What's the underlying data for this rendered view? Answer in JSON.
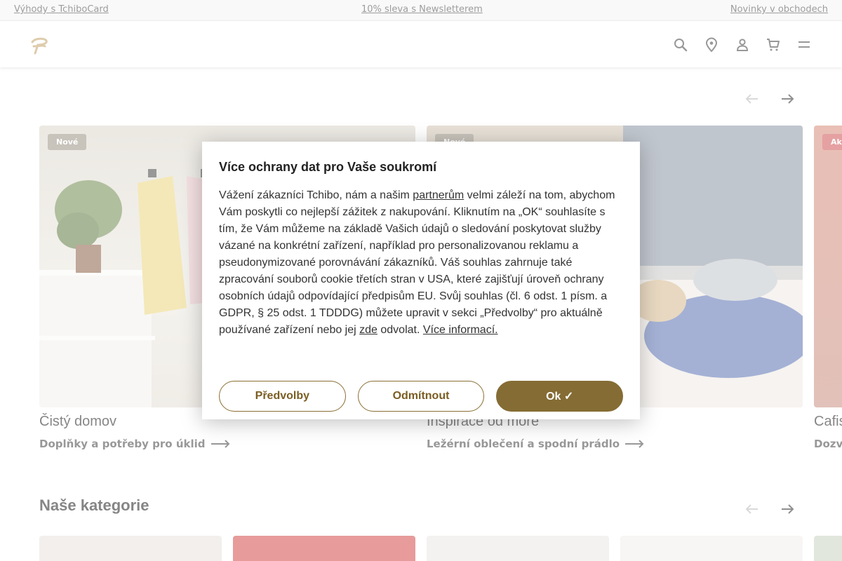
{
  "topbar": {
    "link1": "Výhody s TchiboCard",
    "link2": "10% sleva s Newsletterem",
    "link3": "Novinky v obchodech"
  },
  "header": {
    "icons": [
      "search-icon",
      "location-pin-icon",
      "user-icon",
      "cart-icon",
      "menu-icon"
    ]
  },
  "carousel": {
    "cards": [
      {
        "badge": "Nové",
        "title": "Čistý domov",
        "link": "Doplňky a potřeby pro úklid"
      },
      {
        "badge": "Nové",
        "title": "Inspirace od moře",
        "link": "Ležérní oblečení a spodní prádlo"
      },
      {
        "badge": "Akce",
        "title": "Cafissimo",
        "link": "Dozvědět se více"
      }
    ]
  },
  "categories": {
    "title": "Naše kategorie"
  },
  "modal": {
    "title": "Více ochrany dat pro Vaše soukromí",
    "body_intro": "Vážení zákazníci Tchibo, nám a našim ",
    "partners_link": "partnerům",
    "body_main": " velmi záleží na tom, abychom Vám poskytli co nejlepší zážitek z nakupování. Kliknutím na „OK“ souhlasíte s tím, že Vám můžeme na základě Vašich údajů o sledování poskytovat služby vázané na konkrétní zařízení, například pro personalizovanou reklamu a pseudonymizované porovnávání zákazníků. Váš souhlas zahrnuje také zpracování souborů cookie třetích stran v USA, které zajišťují úroveň ochrany osobních údajů odpovídající předpisům EU. Svůj souhlas (čl. 6 odst. 1 písm. a GDPR, § 25 odst. 1 TDDDG) můžete upravit v sekci „Předvolby“ pro aktuálně používané zařízení nebo jej ",
    "here_link": "zde",
    "body_end": " odvolat. ",
    "more_link": "Více informací.",
    "btn_preferences": "Předvolby",
    "btn_reject": "Odmítnout",
    "btn_ok": "Ok ✓"
  },
  "colors": {
    "brand": "#856c34",
    "topbar_bg": "#f4f4f4"
  }
}
